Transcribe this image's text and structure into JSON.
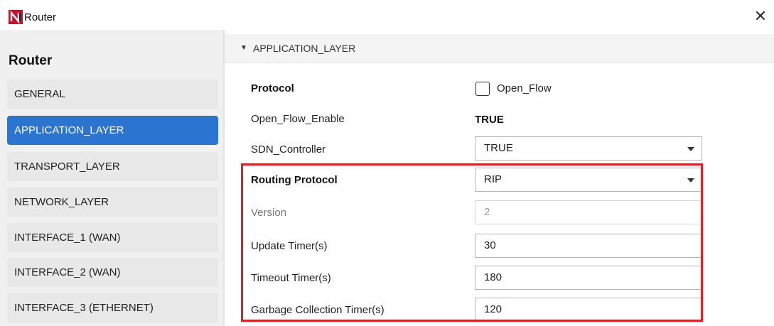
{
  "window": {
    "title": "Router",
    "close_symbol": "✕"
  },
  "sidebar": {
    "title": "Router",
    "items": [
      {
        "label": "GENERAL",
        "active": false
      },
      {
        "label": "APPLICATION_LAYER",
        "active": true
      },
      {
        "label": "TRANSPORT_LAYER",
        "active": false
      },
      {
        "label": "NETWORK_LAYER",
        "active": false
      },
      {
        "label": "INTERFACE_1 (WAN)",
        "active": false
      },
      {
        "label": "INTERFACE_2 (WAN)",
        "active": false
      },
      {
        "label": "INTERFACE_3 (ETHERNET)",
        "active": false
      }
    ]
  },
  "section": {
    "arrow": "▼",
    "title": "APPLICATION_LAYER"
  },
  "form": {
    "protocol": {
      "label": "Protocol",
      "checkbox_label": "Open_Flow",
      "checked": false
    },
    "open_flow_enable": {
      "label": "Open_Flow_Enable",
      "value": "TRUE"
    },
    "sdn_controller": {
      "label": "SDN_Controller",
      "value": "TRUE"
    },
    "routing_protocol": {
      "label": "Routing Protocol",
      "value": "RIP"
    },
    "version": {
      "label": "Version",
      "value": "2"
    },
    "update_timer": {
      "label": "Update Timer(s)",
      "value": "30"
    },
    "timeout_timer": {
      "label": "Timeout Timer(s)",
      "value": "180"
    },
    "garbage_timer": {
      "label": "Garbage Collection Timer(s)",
      "value": "120"
    }
  },
  "colors": {
    "accent": "#2b74cf",
    "highlight": "#e0202a",
    "sidebar_bg": "#f0f0f0"
  }
}
